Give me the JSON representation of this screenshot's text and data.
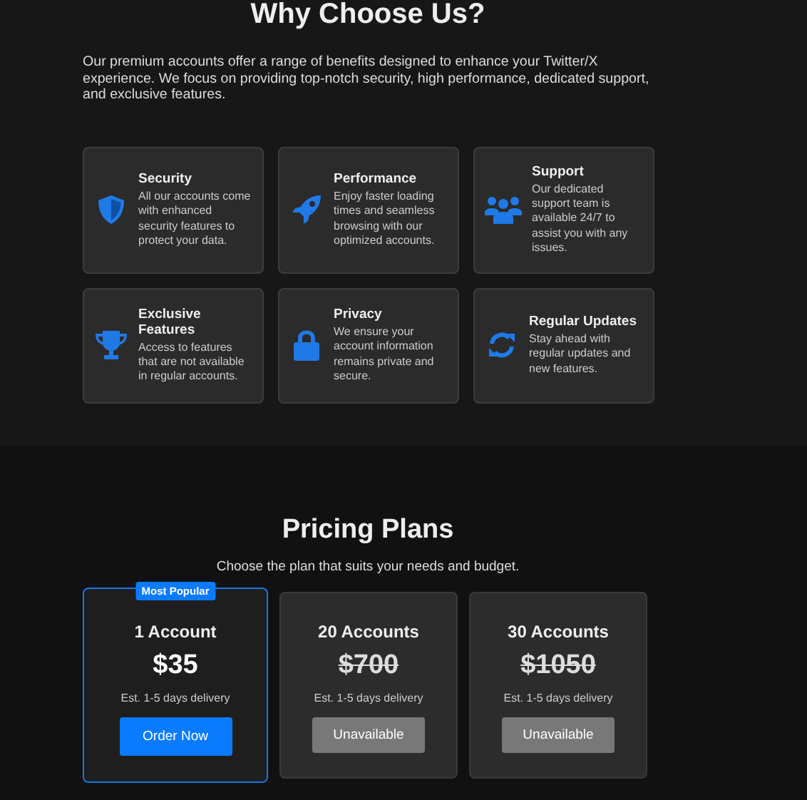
{
  "why": {
    "title": "Why Choose Us?",
    "intro": "Our premium accounts offer a range of benefits designed to enhance your Twitter/X experience. We focus on providing top-notch security, high performance, dedicated support, and exclusive features.",
    "features": [
      {
        "title": "Security",
        "text": "All our accounts come with enhanced security features to protect your data."
      },
      {
        "title": "Performance",
        "text": "Enjoy faster loading times and seamless browsing with our optimized accounts."
      },
      {
        "title": "Support",
        "text": "Our dedicated support team is available 24/7 to assist you with any issues."
      },
      {
        "title": "Exclusive Features",
        "text": "Access to features that are not available in regular accounts."
      },
      {
        "title": "Privacy",
        "text": "We ensure your account information remains private and secure."
      },
      {
        "title": "Regular Updates",
        "text": "Stay ahead with regular updates and new features."
      }
    ]
  },
  "pricing": {
    "title": "Pricing Plans",
    "subtitle": "Choose the plan that suits your needs and budget.",
    "plans": [
      {
        "name": "1 Account",
        "price": "$35",
        "delivery": "Est. 1-5 days delivery",
        "button": "Order Now",
        "available": true,
        "featured": true,
        "badge": "Most Popular"
      },
      {
        "name": "20 Accounts",
        "price": "$700",
        "delivery": "Est. 1-5 days delivery",
        "button": "Unavailable",
        "available": false,
        "featured": false
      },
      {
        "name": "30 Accounts",
        "price": "$1050",
        "delivery": "Est. 1-5 days delivery",
        "button": "Unavailable",
        "available": false,
        "featured": false
      }
    ]
  }
}
